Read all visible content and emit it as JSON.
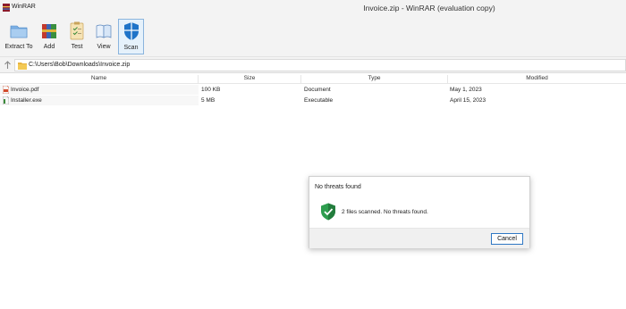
{
  "app": {
    "name": "WinRAR",
    "window_title": "Invoice.zip - WinRAR (evaluation copy)"
  },
  "toolbar": {
    "buttons": [
      {
        "label": "Extract To",
        "icon": "extract-folder-icon"
      },
      {
        "label": "Add",
        "icon": "archive-books-icon"
      },
      {
        "label": "Test",
        "icon": "clipboard-check-icon"
      },
      {
        "label": "View",
        "icon": "book-icon"
      },
      {
        "label": "Scan",
        "icon": "shield-icon",
        "active": true
      }
    ]
  },
  "address": {
    "path": "C:\\Users\\Bob\\Downloads\\Invoice.zip"
  },
  "columns": [
    "Name",
    "Size",
    "Type",
    "Modified"
  ],
  "files": [
    {
      "name": "Invoice.pdf",
      "size": "100 KB",
      "type": "Document",
      "modified": "May 1, 2023",
      "icon": "pdf-file-icon"
    },
    {
      "name": "Installer.exe",
      "size": "5 MB",
      "type": "Executable",
      "modified": "April 15, 2023",
      "icon": "exe-file-icon"
    }
  ],
  "dialog": {
    "title": "No threats found",
    "message": "2 files scanned. No threats found.",
    "cancel_label": "Cancel",
    "icon": "shield-check-icon"
  },
  "colors": {
    "accent": "#1e73c8",
    "shield_green": "#2e9e4f",
    "toolbar_bg": "#f3f3f3"
  }
}
